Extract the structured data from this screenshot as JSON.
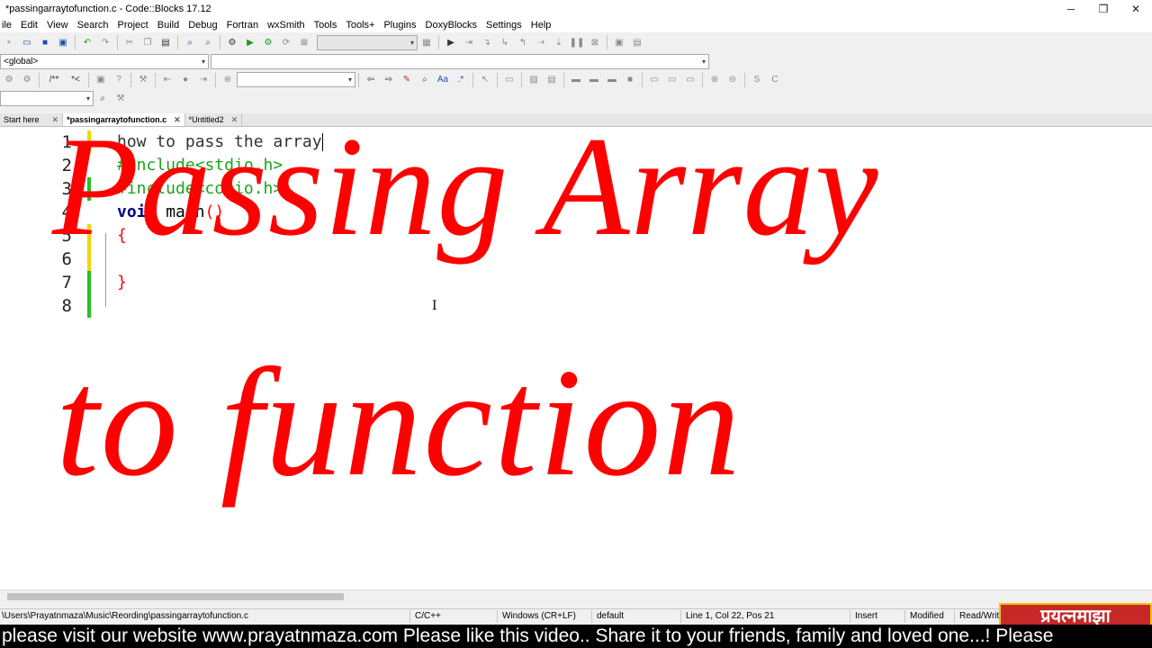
{
  "window": {
    "title": "*passingarraytofunction.c - Code::Blocks 17.12",
    "controls": [
      "─",
      "❐",
      "✕"
    ]
  },
  "menu": [
    "ile",
    "Edit",
    "View",
    "Search",
    "Project",
    "Build",
    "Debug",
    "Fortran",
    "wxSmith",
    "Tools",
    "Tools+",
    "Plugins",
    "DoxyBlocks",
    "Settings",
    "Help"
  ],
  "toolbars": {
    "scope_combo": "<global>",
    "comment_labels": [
      "/**",
      "*<"
    ]
  },
  "tabs": [
    {
      "label": "Start here",
      "active": false
    },
    {
      "label": "*passingarraytofunction.c",
      "active": true
    },
    {
      "label": "*Untitled2",
      "active": false
    }
  ],
  "editor": {
    "line_numbers": [
      "1",
      "2",
      "3",
      "4",
      "5",
      "6",
      "7",
      "8"
    ],
    "lines": [
      {
        "parts": [
          {
            "t": "how to pass the array",
            "c": "#333333"
          }
        ]
      },
      {
        "parts": [
          {
            "t": "#include<stdio.h>",
            "c": "#1aa31a"
          }
        ]
      },
      {
        "parts": [
          {
            "t": "#include<conio.h>",
            "c": "#1aa31a"
          }
        ]
      },
      {
        "parts": [
          {
            "t": "void",
            "c": "#00008b",
            "b": true
          },
          {
            "t": " main",
            "c": "#000000"
          },
          {
            "t": "()",
            "c": "#ff0000"
          }
        ]
      },
      {
        "parts": [
          {
            "t": "{",
            "c": "#ff0000"
          }
        ]
      },
      {
        "parts": []
      },
      {
        "parts": [
          {
            "t": "}",
            "c": "#ff0000"
          }
        ]
      },
      {
        "parts": []
      }
    ],
    "change_colors": {
      "saved": "#22c322",
      "modified": "#f2d600"
    }
  },
  "overlay": {
    "line1": "Passing Array",
    "line2": "to function",
    "color": "#ff0000"
  },
  "status": {
    "path": "\\Users\\Prayatnmaza\\Music\\Reording\\passingarraytofunction.c",
    "language": "C/C++",
    "eol": "Windows (CR+LF)",
    "encoding": "default",
    "position": "Line 1, Col 22, Pos 21",
    "mode": "Insert",
    "modified": "Modified",
    "access": "Read/Writ"
  },
  "logo": {
    "text": "प्रयत्नमाझा"
  },
  "ticker": {
    "text": "please visit our website www.prayatnmaza.com Please like this video.. Share it to your friends, family and loved one...!  Please"
  }
}
